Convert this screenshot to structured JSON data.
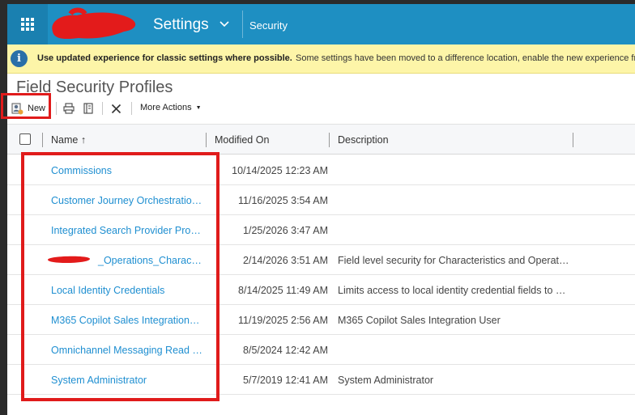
{
  "nav": {
    "title": "Settings",
    "chevron": "chevron-down-icon",
    "breadcrumb": "Security",
    "menu_icon": "waffle-grid-icon"
  },
  "banner": {
    "bold": "Use updated experience for classic settings where possible.",
    "text": "Some settings have been moved to a difference location, enable the new experience fr"
  },
  "page": {
    "title": "Field Security Profiles"
  },
  "toolbar": {
    "new_label": "New",
    "more_label": "More Actions",
    "icons": [
      "new-record-icon",
      "print-icon",
      "book-icon",
      "delete-icon"
    ]
  },
  "grid": {
    "columns": {
      "name": "Name ↑",
      "modified": "Modified On",
      "description": "Description"
    },
    "rows": [
      {
        "name": "Commissions",
        "modified": "10/14/2025 12:23 AM",
        "description": ""
      },
      {
        "name": "Customer Journey Orchestratio…",
        "modified": "11/16/2025 3:54 AM",
        "description": ""
      },
      {
        "name": "Integrated Search Provider Pro…",
        "modified": "1/25/2026 3:47 AM",
        "description": ""
      },
      {
        "name": "_Operations_Characteris…",
        "modified": "2/14/2026 3:51 AM",
        "description": "Field level security for Characteristics and Operat…"
      },
      {
        "name": "Local Identity Credentials",
        "modified": "8/14/2025 11:49 AM",
        "description": "Limits access to local identity credential fields to …"
      },
      {
        "name": "M365 Copilot Sales Integration…",
        "modified": "11/19/2025 2:56 AM",
        "description": "M365 Copilot Sales Integration User"
      },
      {
        "name": "Omnichannel Messaging Read …",
        "modified": "8/5/2024 12:42 AM",
        "description": ""
      },
      {
        "name": "System Administrator",
        "modified": "5/7/2019 12:41 AM",
        "description": "System Administrator"
      }
    ]
  },
  "colors": {
    "nav": "#1e8fc2",
    "banner": "#fdf5a8",
    "link": "#1f8fd1",
    "highlight": "#e01b1b"
  }
}
